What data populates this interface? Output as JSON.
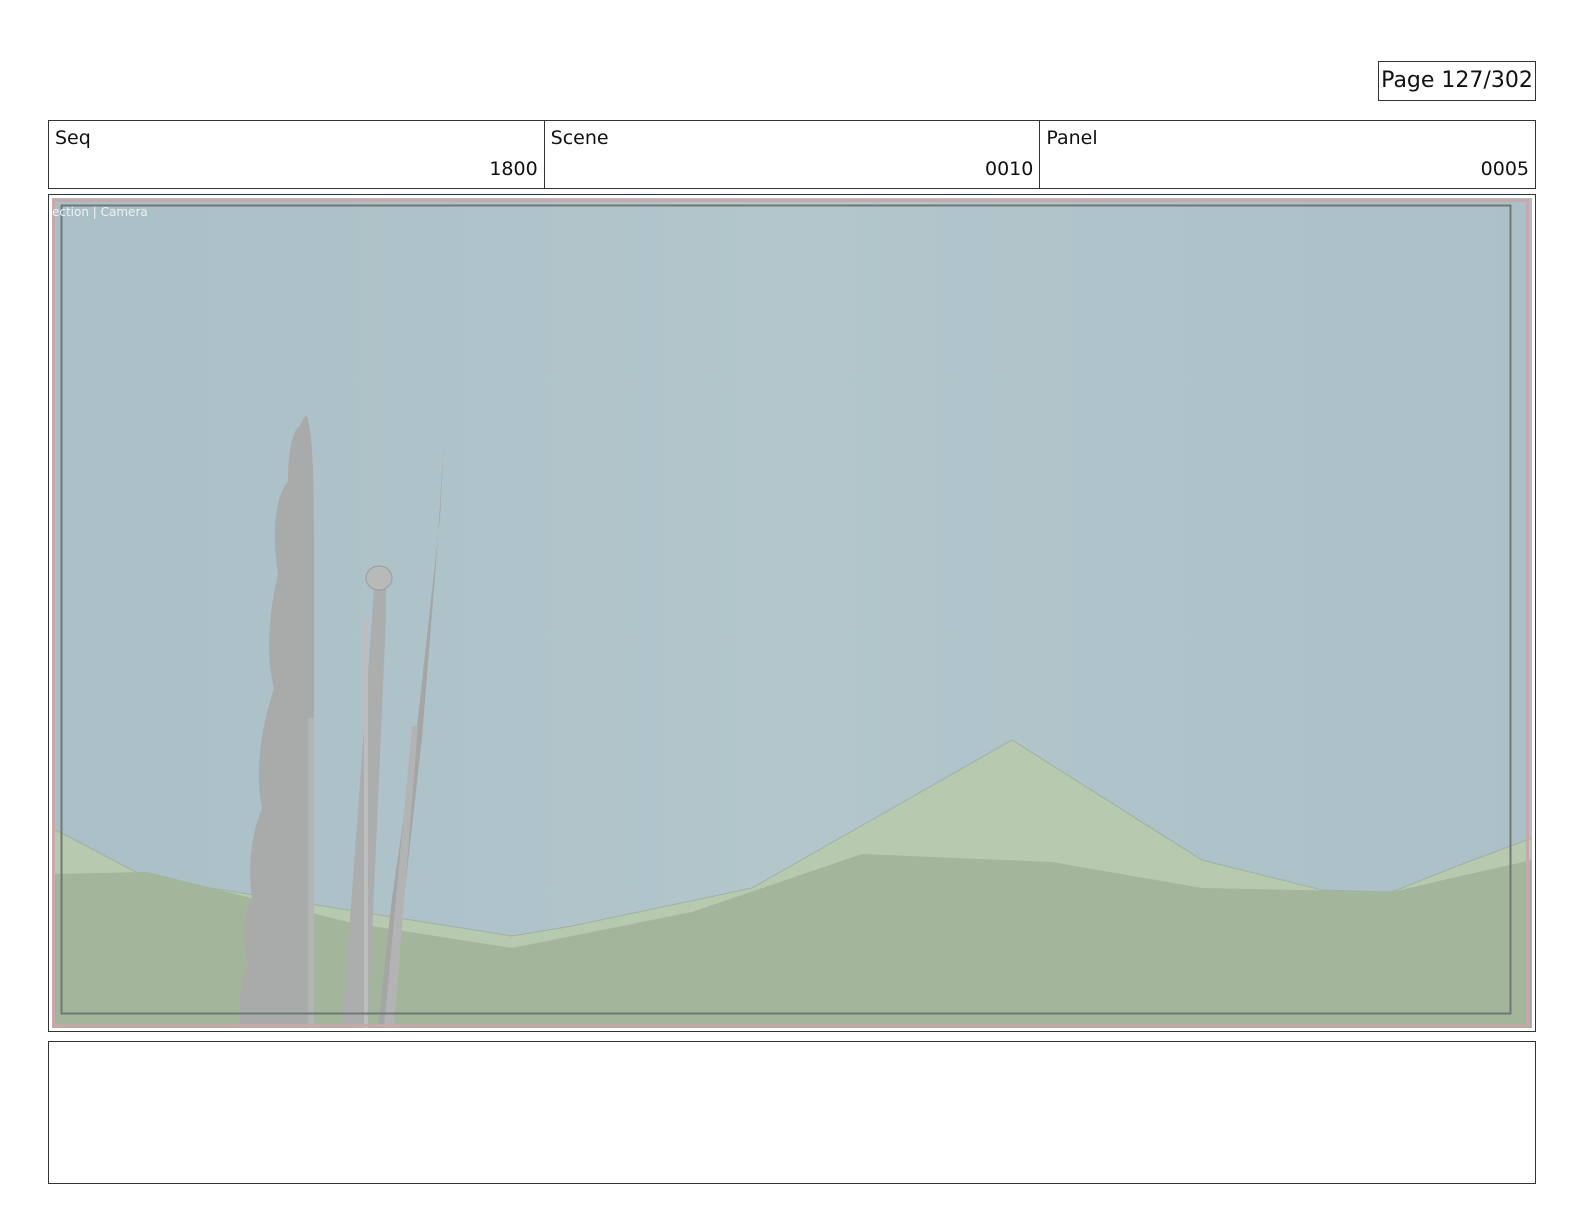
{
  "page": {
    "label": "Page 127/302"
  },
  "header": {
    "fields": [
      {
        "label": "Seq",
        "value": "1800"
      },
      {
        "label": "Scene",
        "value": "0010"
      },
      {
        "label": "Panel",
        "value": "0005"
      }
    ]
  },
  "panel_image": {
    "viewport_label": "ection | Camera",
    "colors": {
      "sky": "#aec4ca",
      "far_hills": "#b6c8ad",
      "near_hills": "#a3b59a",
      "grey_props": "#a9abab",
      "frame_border": "#c8a8a8"
    }
  },
  "notes": {
    "text": ""
  }
}
